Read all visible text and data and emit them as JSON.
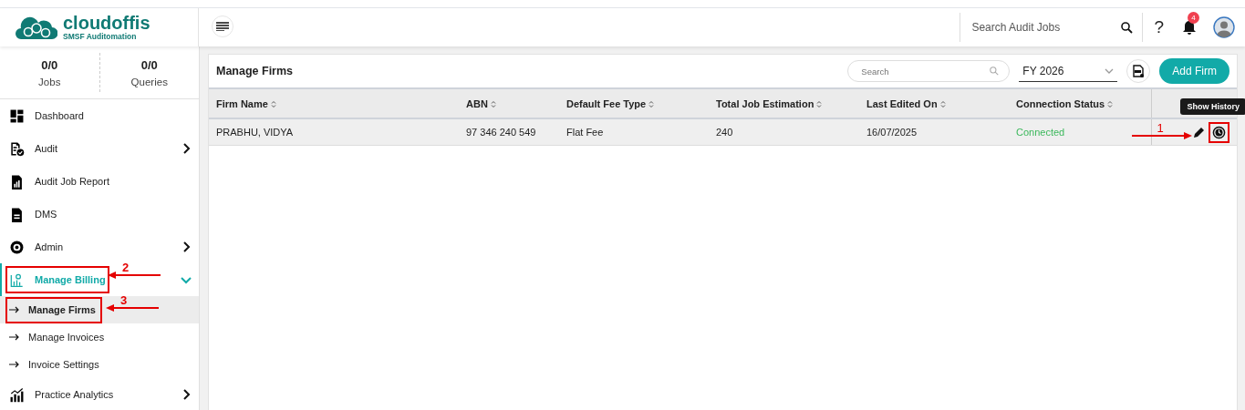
{
  "header": {
    "logo_name": "cloudoffis",
    "logo_tagline": "SMSF Auditomation",
    "search_placeholder": "Search Audit Jobs",
    "help": "?",
    "notification_count": "4"
  },
  "stats": [
    {
      "value": "0/0",
      "label": "Jobs"
    },
    {
      "value": "0/0",
      "label": "Queries"
    }
  ],
  "sidebar": {
    "items": [
      {
        "label": "Dashboard",
        "kind": "dashboard",
        "selected": false
      },
      {
        "label": "Audit",
        "kind": "audit",
        "selected": false,
        "expanded": false
      },
      {
        "label": "Audit Job Report",
        "kind": "report",
        "selected": false
      },
      {
        "label": "DMS",
        "kind": "dms",
        "selected": false
      },
      {
        "label": "Admin",
        "kind": "admin",
        "selected": false,
        "expanded": false
      },
      {
        "label": "Manage Billing",
        "kind": "billing",
        "selected": true,
        "expanded": true,
        "annotation": "2",
        "children": [
          {
            "label": "Manage Firms",
            "selected": true,
            "annotation": "3"
          },
          {
            "label": "Manage Invoices",
            "selected": false
          },
          {
            "label": "Invoice Settings",
            "selected": false
          }
        ]
      },
      {
        "label": "Practice Analytics",
        "kind": "analytics",
        "selected": false,
        "expanded": false
      }
    ]
  },
  "panel": {
    "title": "Manage Firms",
    "search_placeholder": "Search",
    "year": "FY 2026",
    "add_button": "Add Firm",
    "columns": [
      "Firm Name",
      "ABN",
      "Default Fee Type",
      "Total Job Estimation",
      "Last Edited On",
      "Connection Status"
    ],
    "rows": [
      {
        "cells": [
          "PRABHU, VIDYA",
          "97 346 240 549",
          "Flat Fee",
          "240",
          "16/07/2025"
        ],
        "status": "Connected",
        "connected": true,
        "annotation": "1",
        "tooltip": "Show History"
      }
    ]
  }
}
